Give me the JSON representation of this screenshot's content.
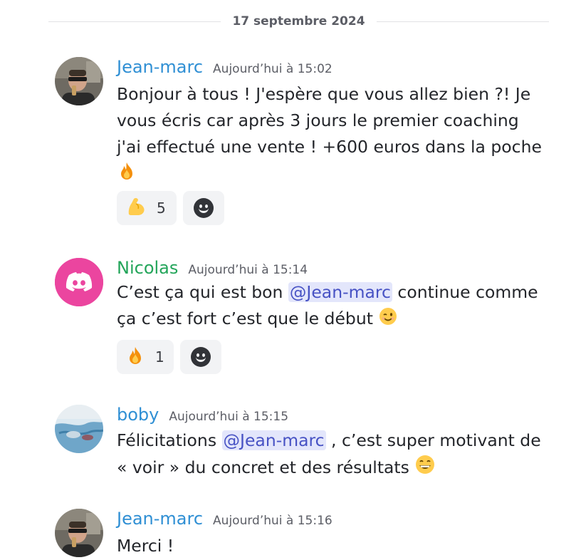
{
  "date_divider": "17 septembre 2024",
  "messages": [
    {
      "username": "Jean-marc",
      "timestamp": "Aujourd’hui à 15:02",
      "text_1": "Bonjour à tous ! J'espère que vous allez bien ?! Je vous écris car après 3 jours le premier coaching j'ai effectué une vente ! +600 euros dans la poche ",
      "reaction_count": "5"
    },
    {
      "username": "Nicolas",
      "timestamp": "Aujourd’hui à 15:14",
      "text_1": "C’est ça qui est bon ",
      "mention": "@Jean-marc",
      "text_2": " continue comme ça c’est fort c’est que le début ",
      "reaction_count": "1"
    },
    {
      "username": "boby",
      "timestamp": "Aujourd’hui à 15:15",
      "text_1": "Félicitations ",
      "mention": "@Jean-marc",
      "text_2": " , c’est super motivant de « voir » du concret et des résultats "
    },
    {
      "username": "Jean-marc",
      "timestamp": "Aujourd’hui à 15:16",
      "text_1": "Merci !"
    }
  ],
  "colors": {
    "jean_marc": "#2f8fd4",
    "nicolas": "#23a55a",
    "boby": "#2f8fd4",
    "discord_pink": "#eb459f",
    "mention_bg": "#e3e6fb",
    "mention_text": "#4752c4"
  },
  "icons": {
    "fire": "fire-emoji",
    "flexed_biceps": "flexed-biceps-emoji",
    "wink": "winking-face-emoji",
    "grin": "grinning-face-emoji",
    "add_reaction": "add-reaction-smiley-icon",
    "discord": "discord-logo-icon"
  }
}
